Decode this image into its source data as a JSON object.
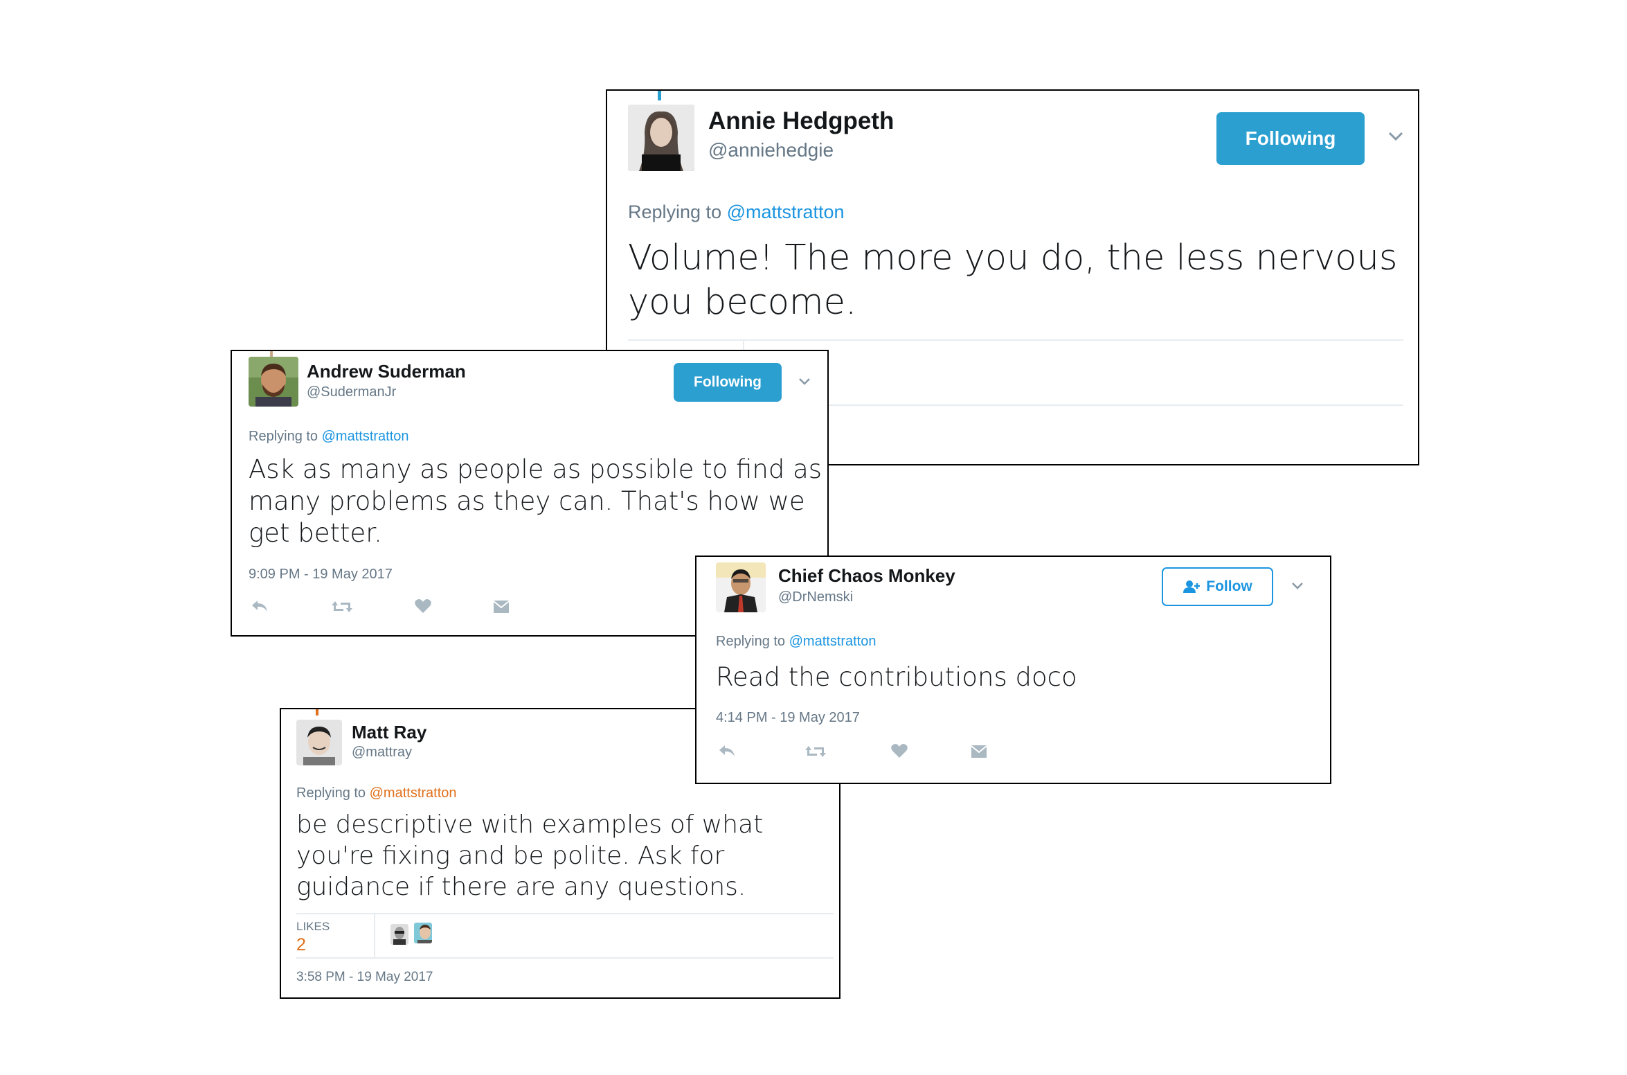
{
  "tweets": {
    "annie": {
      "name": "Annie Hedgpeth",
      "handle": "@anniehedgie",
      "button": "Following",
      "replying_prefix": "Replying to ",
      "replying_to": "@mattstratton",
      "text": "Volume! The more you do, the less nervous you become."
    },
    "andrew": {
      "name": "Andrew Suderman",
      "handle": "@SudermanJr",
      "button": "Following",
      "replying_prefix": "Replying to ",
      "replying_to": "@mattstratton",
      "text": "Ask as many as people as possible to find as many problems as they can. That's how we get better.",
      "timestamp": "9:09 PM - 19 May 2017"
    },
    "chief": {
      "name": "Chief Chaos Monkey",
      "handle": "@DrNemski",
      "button": "Follow",
      "replying_prefix": "Replying to ",
      "replying_to": "@mattstratton",
      "text": "Read the contributions doco",
      "timestamp": "4:14 PM - 19 May 2017"
    },
    "matt": {
      "name": "Matt Ray",
      "handle": "@mattray",
      "replying_prefix": "Replying to ",
      "replying_to": "@mattstratton",
      "text": "be descriptive with examples of what you're fixing and be polite. Ask for guidance if there are any questions.",
      "likes_label": "LIKES",
      "likes_count": "2",
      "timestamp": "3:58 PM - 19 May 2017"
    }
  },
  "colors": {
    "accent": "#1b95e0",
    "following_bg": "#2b9fd0",
    "muted": "#657786",
    "highlight": "#e0701c"
  },
  "icons": [
    "reply-icon",
    "retweet-icon",
    "like-icon",
    "message-icon",
    "chevron-down-icon",
    "follow-person-icon"
  ]
}
